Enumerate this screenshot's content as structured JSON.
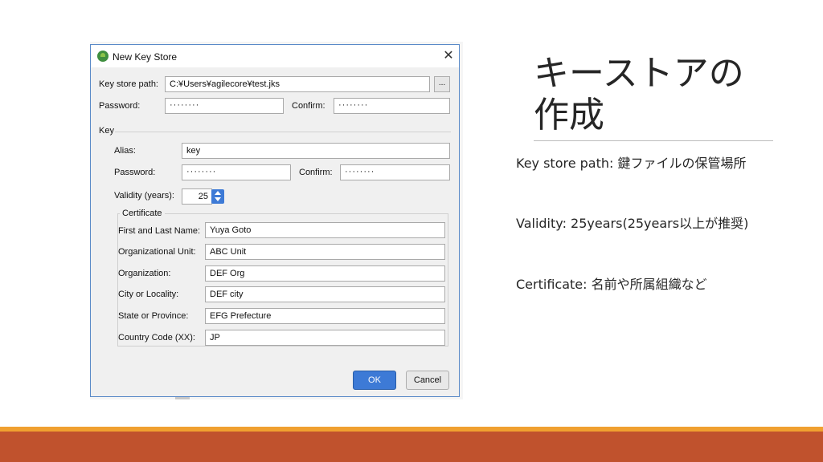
{
  "slide": {
    "title": "キーストアの作成",
    "bullets": [
      "Key store path: 鍵ファイルの保管場所",
      "Validity: 25years(25years以上が推奨)",
      "Certificate: 名前や所属組織など"
    ],
    "accent_colors": {
      "thin_bar": "#f0a030",
      "thick_bar": "#c0522d"
    }
  },
  "dialog": {
    "title": "New Key Store",
    "close_icon": "close-icon",
    "key_store_path": {
      "label": "Key store path:",
      "value": "C:¥Users¥agilecore¥test.jks",
      "browse_label": "..."
    },
    "password": {
      "label": "Password:",
      "value": "········"
    },
    "confirm": {
      "label": "Confirm:",
      "value": "········"
    },
    "key_section_label": "Key",
    "alias": {
      "label": "Alias:",
      "value": "key"
    },
    "key_password": {
      "label": "Password:",
      "value": "········"
    },
    "key_confirm": {
      "label": "Confirm:",
      "value": "········"
    },
    "validity": {
      "label": "Validity (years):",
      "value": "25"
    },
    "certificate": {
      "legend": "Certificate",
      "first_last_name": {
        "label": "First and Last Name:",
        "value": "Yuya Goto"
      },
      "org_unit": {
        "label": "Organizational Unit:",
        "value": "ABC Unit"
      },
      "organization": {
        "label": "Organization:",
        "value": "DEF Org"
      },
      "city": {
        "label": "City or Locality:",
        "value": "DEF city"
      },
      "state": {
        "label": "State or Province:",
        "value": "EFG Prefecture"
      },
      "country": {
        "label": "Country Code (XX):",
        "value": "JP"
      }
    },
    "ok_label": "OK",
    "cancel_label": "Cancel",
    "accent_color": "#3d7ad6"
  }
}
